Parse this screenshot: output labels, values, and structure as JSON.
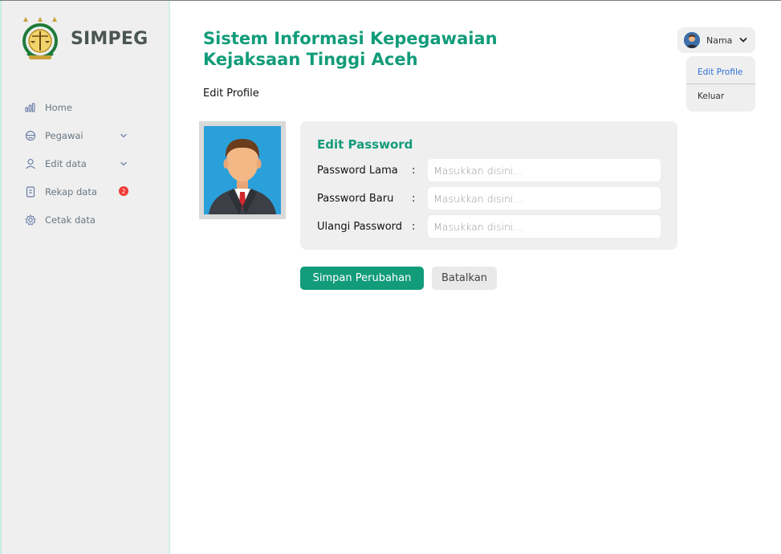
{
  "brand": {
    "name": "SIMPEG",
    "logo": "kejaksaan-emblem"
  },
  "sidebar": {
    "items": [
      {
        "label": "Home",
        "icon": "bar-chart-icon"
      },
      {
        "label": "Pegawai",
        "icon": "employee-icon",
        "expandable": true
      },
      {
        "label": "Edit data",
        "icon": "user-icon",
        "expandable": true
      },
      {
        "label": "Rekap data",
        "icon": "document-icon",
        "badge": "2"
      },
      {
        "label": "Cetak data",
        "icon": "gear-icon"
      }
    ]
  },
  "header": {
    "title": "Sistem Informasi Kepegawaian Kejaksaan Tinggi Aceh",
    "page_title": "Edit Profile"
  },
  "user_menu": {
    "name": "Nama",
    "items": [
      "Edit Profile",
      "Keluar"
    ]
  },
  "form": {
    "title": "Edit Password",
    "fields": [
      {
        "label": "Password Lama",
        "separator": ":",
        "value": "",
        "placeholder": "Masukkan disini..."
      },
      {
        "label": "Password Baru",
        "separator": ":",
        "value": "",
        "placeholder": "Masukkan disini..."
      },
      {
        "label": "Ulangi Password",
        "separator": ":",
        "value": "",
        "placeholder": "Masukkan disini..."
      }
    ],
    "save_label": "Simpan Perubahan",
    "cancel_label": "Batalkan"
  },
  "colors": {
    "primary": "#129c7a",
    "sidebar_bg": "#efefef",
    "badge": "#ef3a34",
    "link": "#2f6fd6"
  }
}
